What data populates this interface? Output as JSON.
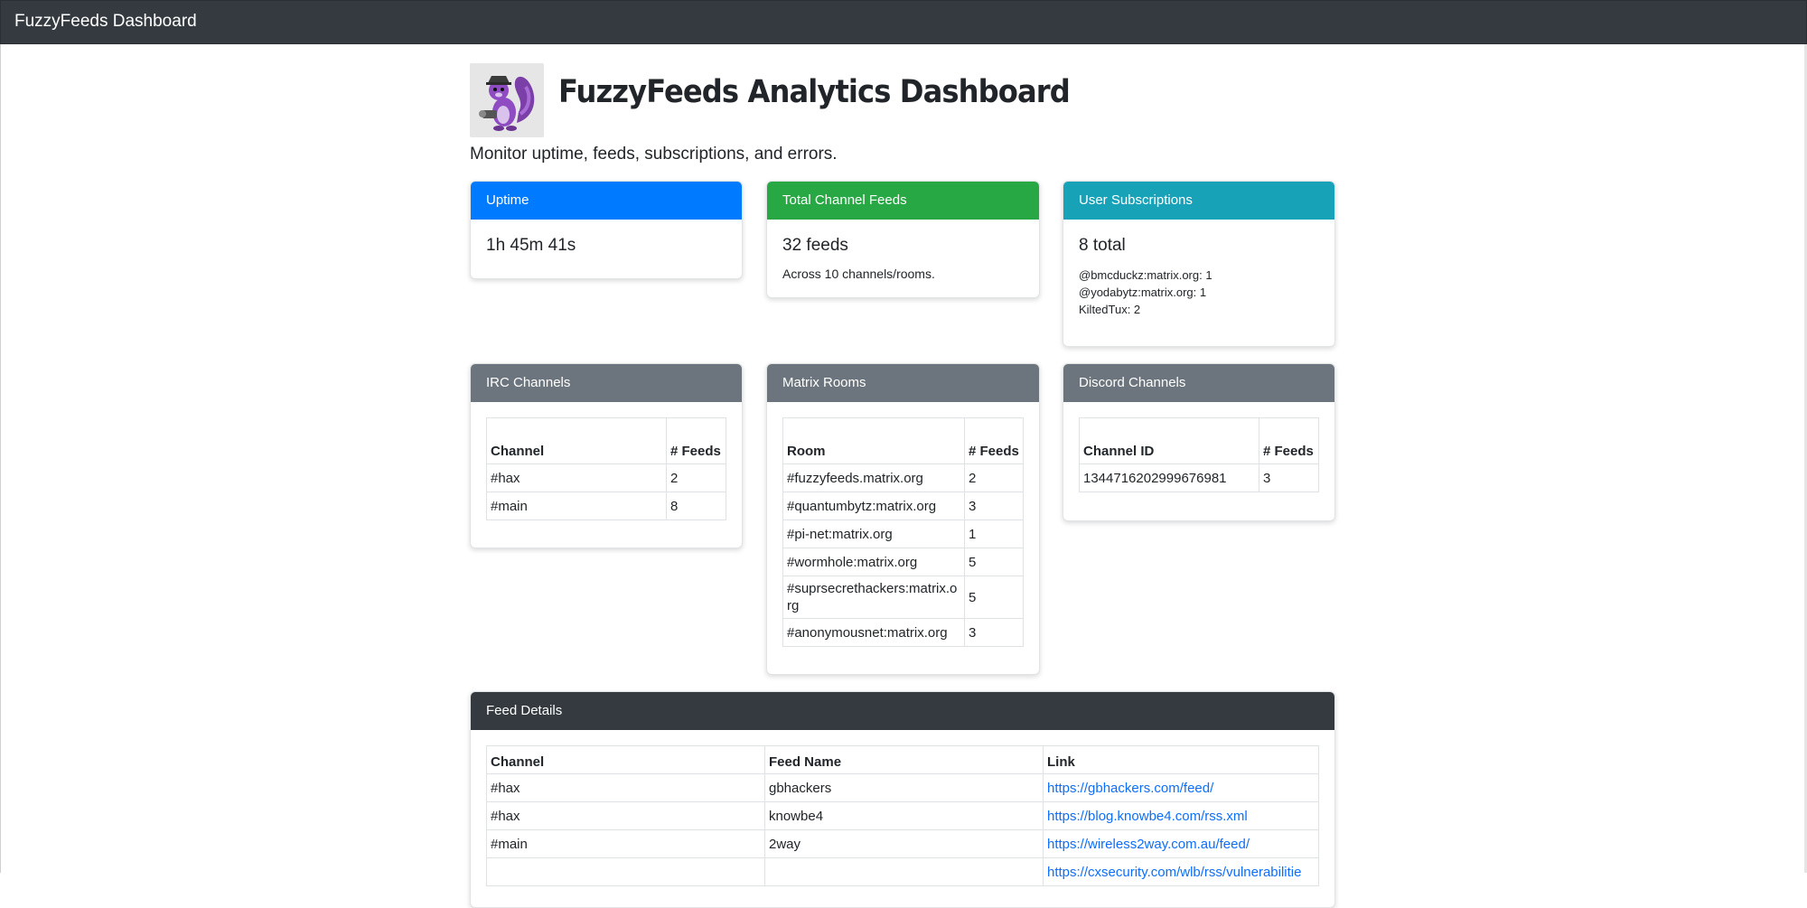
{
  "navbar": {
    "brand": "FuzzyFeeds Dashboard"
  },
  "header": {
    "title": "FuzzyFeeds Analytics Dashboard",
    "subtitle": "Monitor uptime, feeds, subscriptions, and errors."
  },
  "colors": {
    "navbar": "#343a40",
    "uptime": "#007bff",
    "feeds": "#28a745",
    "subscriptions": "#17a2b8",
    "channels": "#6c757d",
    "details": "#343a40",
    "link": "#0d6efd"
  },
  "uptime": {
    "header": "Uptime",
    "value": "1h 45m 41s"
  },
  "total_feeds": {
    "header": "Total Channel Feeds",
    "value": "32 feeds",
    "detail": "Across 10 channels/rooms."
  },
  "subscriptions": {
    "header": "User Subscriptions",
    "value": "8 total",
    "users": [
      "@bmcduckz:matrix.org: 1",
      "@yodabytz:matrix.org: 1",
      "KiltedTux: 2"
    ]
  },
  "irc": {
    "header": "IRC Channels",
    "columns": [
      "Channel",
      "# Feeds"
    ],
    "rows": [
      [
        "#hax",
        "2"
      ],
      [
        "#main",
        "8"
      ]
    ]
  },
  "matrix": {
    "header": "Matrix Rooms",
    "columns": [
      "Room",
      "# Feeds"
    ],
    "rows": [
      [
        "#fuzzyfeeds.matrix.org",
        "2"
      ],
      [
        "#quantumbytz:matrix.org",
        "3"
      ],
      [
        "#pi-net:matrix.org",
        "1"
      ],
      [
        "#wormhole:matrix.org",
        "5"
      ],
      [
        "#suprsecrethackers:matrix.org",
        "5"
      ],
      [
        "#anonymousnet:matrix.org",
        "3"
      ]
    ]
  },
  "discord": {
    "header": "Discord Channels",
    "columns": [
      "Channel ID",
      "# Feeds"
    ],
    "rows": [
      [
        "1344716202999676981",
        "3"
      ]
    ]
  },
  "feed_details": {
    "header": "Feed Details",
    "columns": [
      "Channel",
      "Feed Name",
      "Link"
    ],
    "rows": [
      [
        "#hax",
        "gbhackers",
        "https://gbhackers.com/feed/"
      ],
      [
        "#hax",
        "knowbe4",
        "https://blog.knowbe4.com/rss.xml"
      ],
      [
        "#main",
        "2way",
        "https://wireless2way.com.au/feed/"
      ],
      [
        "",
        "",
        "https://cxsecurity.com/wlb/rss/vulnerabilitie"
      ]
    ]
  }
}
